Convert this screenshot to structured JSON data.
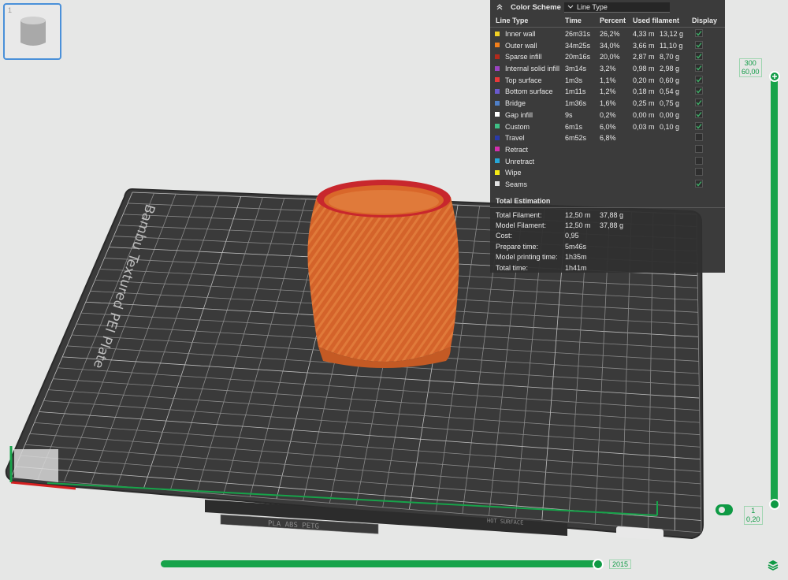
{
  "thumbnail": {
    "index": "1"
  },
  "color_scheme": {
    "title": "Color Scheme",
    "selected": "Line Type",
    "columns": {
      "line_type": "Line Type",
      "time": "Time",
      "percent": "Percent",
      "used": "Used filament",
      "display": "Display"
    },
    "rows": [
      {
        "name": "Inner wall",
        "color": "#f2d024",
        "time": "26m31s",
        "pct": "26,2%",
        "m": "4,33 m",
        "g": "13,12 g",
        "checked": true
      },
      {
        "name": "Outer wall",
        "color": "#f27f1b",
        "time": "34m25s",
        "pct": "34,0%",
        "m": "3,66 m",
        "g": "11,10 g",
        "checked": true
      },
      {
        "name": "Sparse infill",
        "color": "#b22a1c",
        "time": "20m16s",
        "pct": "20,0%",
        "m": "2,87 m",
        "g": "8,70 g",
        "checked": true
      },
      {
        "name": "Internal solid infill",
        "color": "#9b44c2",
        "time": "3m14s",
        "pct": "3,2%",
        "m": "0,98 m",
        "g": "2,98 g",
        "checked": true
      },
      {
        "name": "Top surface",
        "color": "#e8383a",
        "time": "1m3s",
        "pct": "1,1%",
        "m": "0,20 m",
        "g": "0,60 g",
        "checked": true
      },
      {
        "name": "Bottom surface",
        "color": "#6a5acd",
        "time": "1m11s",
        "pct": "1,2%",
        "m": "0,18 m",
        "g": "0,54 g",
        "checked": true
      },
      {
        "name": "Bridge",
        "color": "#4f7fc7",
        "time": "1m36s",
        "pct": "1,6%",
        "m": "0,25 m",
        "g": "0,75 g",
        "checked": true
      },
      {
        "name": "Gap infill",
        "color": "#ffffff",
        "time": "9s",
        "pct": "0,2%",
        "m": "0,00 m",
        "g": "0,00 g",
        "checked": true
      },
      {
        "name": "Custom",
        "color": "#3fbf86",
        "time": "6m1s",
        "pct": "6,0%",
        "m": "0,03 m",
        "g": "0,10 g",
        "checked": true
      },
      {
        "name": "Travel",
        "color": "#2a3aa8",
        "time": "6m52s",
        "pct": "6,8%",
        "m": "",
        "g": "",
        "checked": false
      },
      {
        "name": "Retract",
        "color": "#d42fae",
        "time": "",
        "pct": "",
        "m": "",
        "g": "",
        "checked": false
      },
      {
        "name": "Unretract",
        "color": "#27a6d8",
        "time": "",
        "pct": "",
        "m": "",
        "g": "",
        "checked": false
      },
      {
        "name": "Wipe",
        "color": "#f5ea16",
        "time": "",
        "pct": "",
        "m": "",
        "g": "",
        "checked": false
      },
      {
        "name": "Seams",
        "color": "#e3e3e3",
        "time": "",
        "pct": "",
        "m": "",
        "g": "",
        "checked": true
      }
    ]
  },
  "total_estimation": {
    "title": "Total Estimation",
    "rows": [
      {
        "label": "Total Filament:",
        "v1": "12,50 m",
        "v2": "37,88 g"
      },
      {
        "label": "Model Filament:",
        "v1": "12,50 m",
        "v2": "37,88 g"
      },
      {
        "label": "Cost:",
        "v1": "0,95",
        "v2": ""
      },
      {
        "label": "Prepare time:",
        "v1": "5m46s",
        "v2": ""
      },
      {
        "label": "Model printing time:",
        "v1": "1h35m",
        "v2": ""
      },
      {
        "label": "Total time:",
        "v1": "1h41m",
        "v2": ""
      }
    ]
  },
  "plate": {
    "name": "Bambu Textured PEI Plate",
    "materials": "PLA ABS PETG",
    "surface": "HOT SURFACE"
  },
  "layer_slider": {
    "top_layer": "300",
    "top_height": "60,00",
    "bottom_layer": "1",
    "bottom_height": "0,20"
  },
  "move_slider": {
    "value": "2015"
  },
  "colors": {
    "accent": "#0e9a44",
    "model": "#d9672a",
    "rim": "#c8272d"
  }
}
